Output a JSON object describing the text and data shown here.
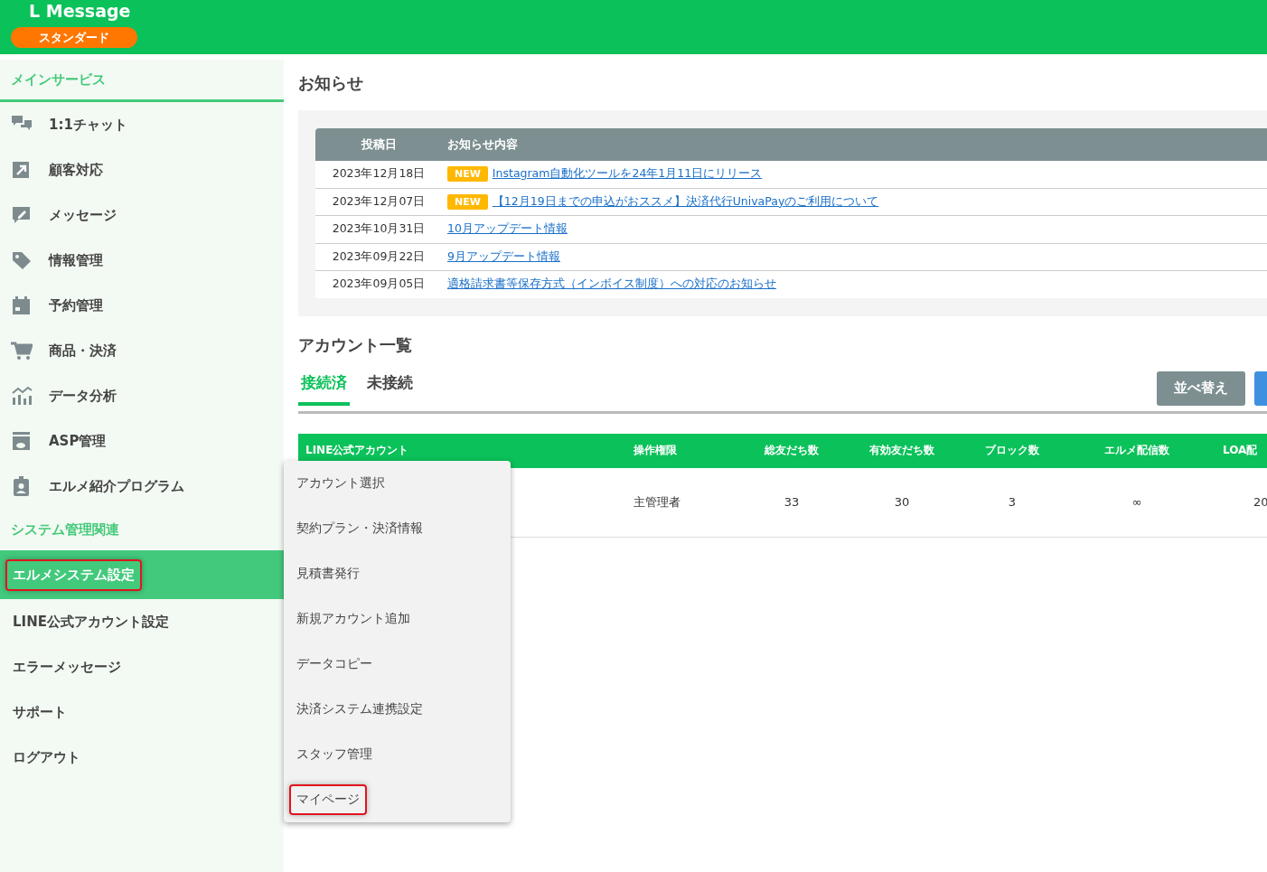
{
  "header": {
    "logo": "L Message",
    "plan_badge": "スタンダード"
  },
  "sidebar": {
    "items": [
      {
        "kind": "heading",
        "label": "メインサービス"
      },
      {
        "kind": "link",
        "label": "1:1チャット",
        "selected": false,
        "highlighted": false
      },
      {
        "kind": "link",
        "label": "顧客対応",
        "selected": false,
        "highlighted": false
      },
      {
        "kind": "link",
        "label": "メッセージ",
        "selected": false,
        "highlighted": false
      },
      {
        "kind": "link",
        "label": "情報管理",
        "selected": false,
        "highlighted": false
      },
      {
        "kind": "link",
        "label": "予約管理",
        "selected": false,
        "highlighted": false
      },
      {
        "kind": "link",
        "label": "商品・決済",
        "selected": false,
        "highlighted": false
      },
      {
        "kind": "link",
        "label": "データ分析",
        "selected": false,
        "highlighted": false
      },
      {
        "kind": "link",
        "label": "ASP管理",
        "selected": false,
        "highlighted": false
      },
      {
        "kind": "link",
        "label": "エルメ紹介プログラム",
        "selected": false,
        "highlighted": false
      },
      {
        "kind": "subheading",
        "label": "システム管理関連"
      },
      {
        "kind": "plain",
        "label": "エルメシステム設定",
        "selected": true,
        "highlighted": true
      },
      {
        "kind": "plain",
        "label": "LINE公式アカウント設定",
        "selected": false,
        "highlighted": false
      },
      {
        "kind": "plain",
        "label": "エラーメッセージ",
        "selected": false,
        "highlighted": false
      },
      {
        "kind": "plain",
        "label": "サポート",
        "selected": false,
        "highlighted": false
      },
      {
        "kind": "plain",
        "label": "ログアウト",
        "selected": false,
        "highlighted": false
      }
    ]
  },
  "news": {
    "title": "お知らせ",
    "columns": [
      "投稿日",
      "お知らせ内容"
    ],
    "rows": [
      {
        "date": "2023年12月18日",
        "is_new": true,
        "badge": "NEW",
        "link": "Instagram自動化ツールを24年1月11日にリリース"
      },
      {
        "date": "2023年12月07日",
        "is_new": true,
        "badge": "NEW",
        "link": "【12月19日までの申込がおススメ】決済代行UnivaPayのご利用について"
      },
      {
        "date": "2023年10月31日",
        "is_new": false,
        "link": "10月アップデート情報"
      },
      {
        "date": "2023年09月22日",
        "is_new": false,
        "link": "9月アップデート情報"
      },
      {
        "date": "2023年09月05日",
        "is_new": false,
        "link": "適格請求書等保存方式（インボイス制度）への対応のお知らせ"
      }
    ]
  },
  "accounts": {
    "title": "アカウント一覧",
    "tabs": [
      {
        "label": "接続済",
        "selected": true
      },
      {
        "label": "未接続",
        "selected": false
      }
    ],
    "sort_button": "並べ替え",
    "columns": [
      "LINE公式アカウント",
      "操作権限",
      "総友だち数",
      "有効友だち数",
      "ブロック数",
      "エルメ配信数",
      "LOA配"
    ],
    "rows": [
      {
        "cells": [
          "",
          "主管理者",
          "33",
          "30",
          "3",
          "∞",
          "20"
        ]
      }
    ]
  },
  "dropdown_menu": {
    "items": [
      {
        "label": "アカウント選択",
        "highlighted": false
      },
      {
        "label": "契約プラン・決済情報",
        "highlighted": false
      },
      {
        "label": "見積書発行",
        "highlighted": false
      },
      {
        "label": "新規アカウント追加",
        "highlighted": false
      },
      {
        "label": "データコピー",
        "highlighted": false
      },
      {
        "label": "決済システム連携設定",
        "highlighted": false
      },
      {
        "label": "スタッフ管理",
        "highlighted": false
      },
      {
        "label": "マイページ",
        "highlighted": true
      }
    ]
  }
}
